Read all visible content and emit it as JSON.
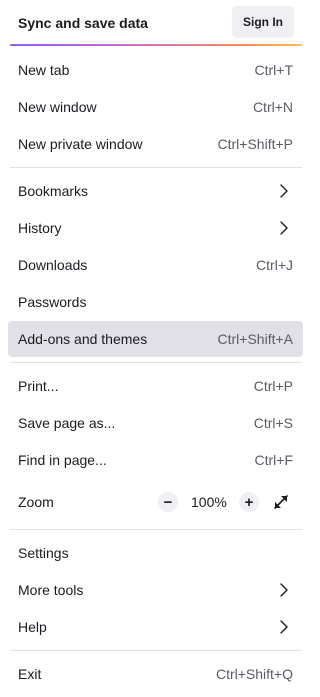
{
  "header": {
    "title": "Sync and save data",
    "sign_in_label": "Sign In"
  },
  "menu": {
    "new_tab": {
      "label": "New tab",
      "shortcut": "Ctrl+T"
    },
    "new_window": {
      "label": "New window",
      "shortcut": "Ctrl+N"
    },
    "new_private_window": {
      "label": "New private window",
      "shortcut": "Ctrl+Shift+P"
    },
    "bookmarks": {
      "label": "Bookmarks",
      "icon": "chevron-right-icon"
    },
    "history": {
      "label": "History",
      "icon": "chevron-right-icon"
    },
    "downloads": {
      "label": "Downloads",
      "shortcut": "Ctrl+J"
    },
    "passwords": {
      "label": "Passwords"
    },
    "addons": {
      "label": "Add-ons and themes",
      "shortcut": "Ctrl+Shift+A",
      "highlighted": true
    },
    "print": {
      "label": "Print...",
      "shortcut": "Ctrl+P"
    },
    "save_page": {
      "label": "Save page as...",
      "shortcut": "Ctrl+S"
    },
    "find": {
      "label": "Find in page...",
      "shortcut": "Ctrl+F"
    },
    "zoom": {
      "label": "Zoom",
      "minus": "−",
      "value": "100%",
      "plus": "+",
      "fullscreen_icon": "fullscreen-icon"
    },
    "settings": {
      "label": "Settings"
    },
    "more_tools": {
      "label": "More tools",
      "icon": "chevron-right-icon"
    },
    "help": {
      "label": "Help",
      "icon": "chevron-right-icon"
    },
    "exit": {
      "label": "Exit",
      "shortcut": "Ctrl+Shift+Q"
    }
  },
  "colors": {
    "text": "#1c1b22",
    "shortcut_text": "#5b5b66",
    "highlight_bg": "#e0e0e6",
    "button_bg": "#f0f0f4",
    "separator": "#e0e0e6",
    "gradient": [
      "#9059ff",
      "#d46fc3",
      "#ff8a50",
      "#ffbd4f"
    ]
  }
}
